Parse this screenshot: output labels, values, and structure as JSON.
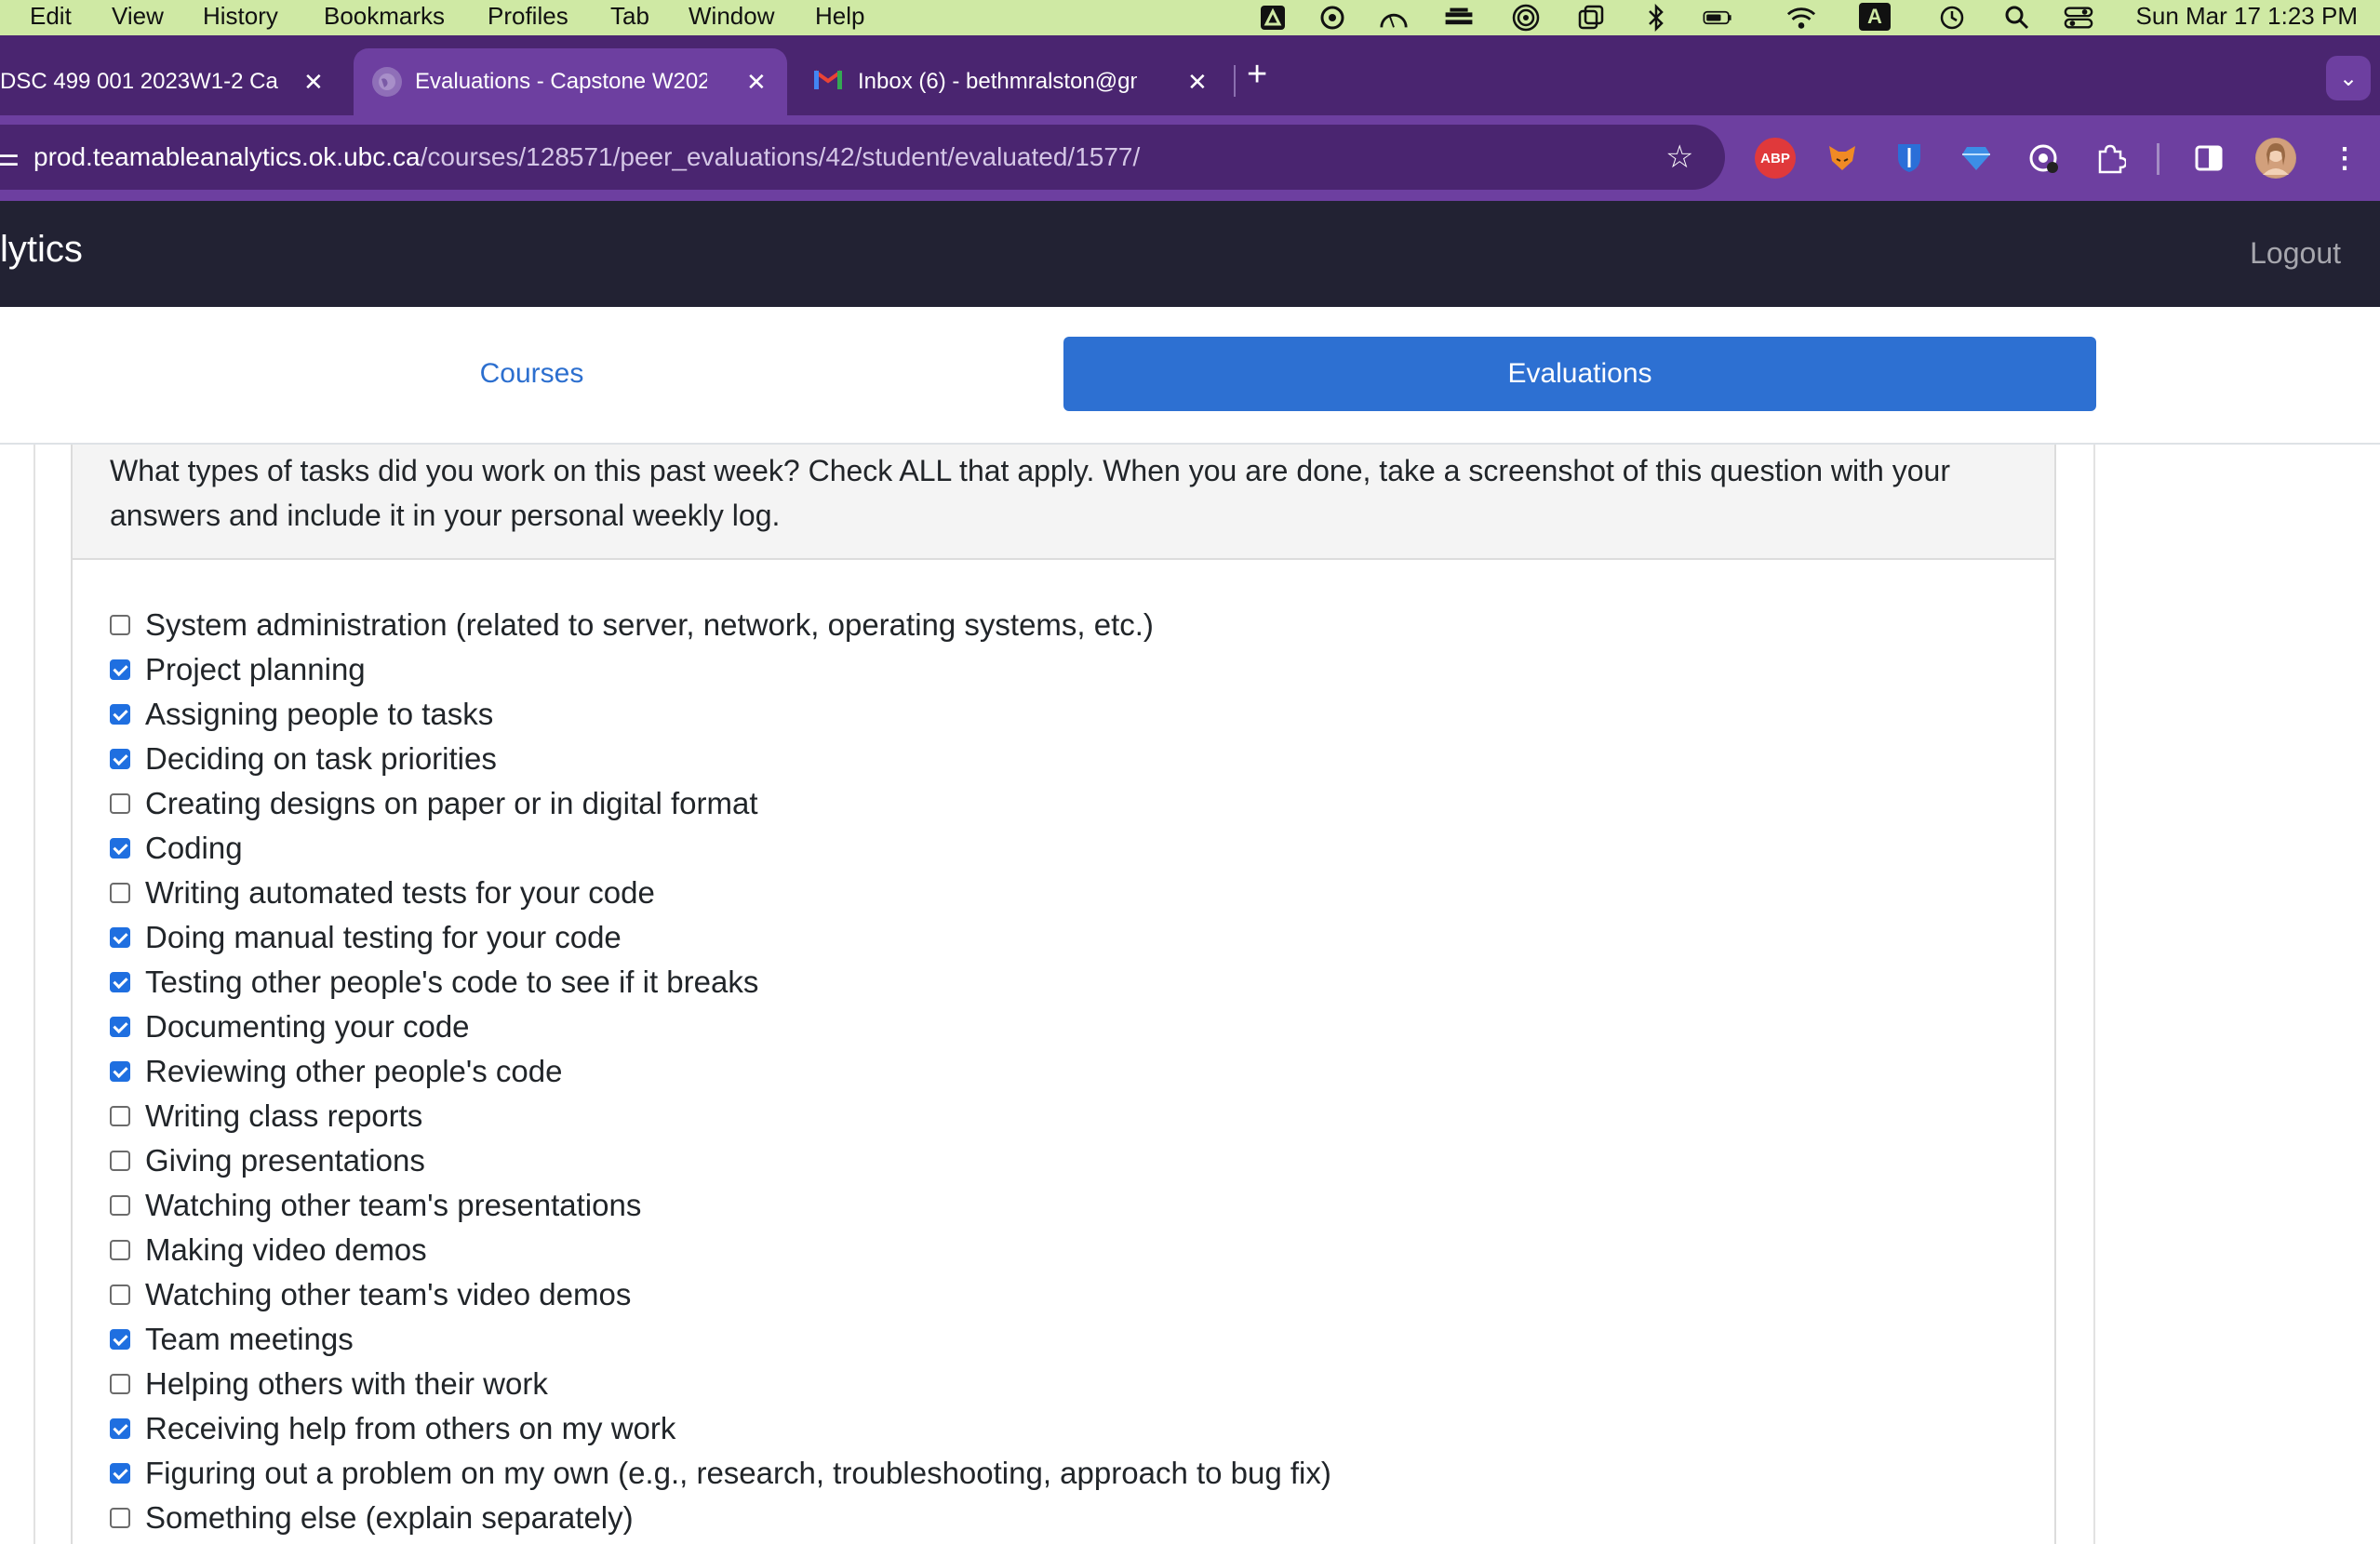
{
  "menubar": {
    "items": [
      "Edit",
      "View",
      "History",
      "Bookmarks",
      "Profiles",
      "Tab",
      "Window",
      "Help"
    ],
    "keyboard_badge": "A",
    "datetime": "Sun Mar 17  1:23 PM"
  },
  "tabs": [
    {
      "title": "DSC 499 001 2023W1-2 Ca",
      "active": false
    },
    {
      "title": "Evaluations - Capstone W202",
      "active": true
    },
    {
      "title": "Inbox (6) - bethmralston@gm",
      "active": false
    }
  ],
  "address": {
    "domain": "prod.teamableanalytics.ok.ubc.ca",
    "path": "/courses/128571/peer_evaluations/42/student/evaluated/1577/"
  },
  "extensions": {
    "abp_label": "ABP"
  },
  "site": {
    "brand": "lytics",
    "logout": "Logout"
  },
  "nav": {
    "courses": "Courses",
    "evaluations": "Evaluations"
  },
  "question": {
    "text": "What types of tasks did you work on this past week? Check ALL that apply. When you are done, take a screenshot of this question with your answers and include it in your personal weekly log.",
    "options": [
      {
        "label": "System administration (related to server, network, operating systems, etc.)",
        "checked": false
      },
      {
        "label": "Project planning",
        "checked": true
      },
      {
        "label": "Assigning people to tasks",
        "checked": true
      },
      {
        "label": "Deciding on task priorities",
        "checked": true
      },
      {
        "label": "Creating designs on paper or in digital format",
        "checked": false
      },
      {
        "label": "Coding",
        "checked": true
      },
      {
        "label": "Writing automated tests for your code",
        "checked": false
      },
      {
        "label": "Doing manual testing for your code",
        "checked": true
      },
      {
        "label": "Testing other people's code to see if it breaks",
        "checked": true
      },
      {
        "label": "Documenting your code",
        "checked": true
      },
      {
        "label": "Reviewing other people's code",
        "checked": true
      },
      {
        "label": "Writing class reports",
        "checked": false
      },
      {
        "label": "Giving presentations",
        "checked": false
      },
      {
        "label": "Watching other team's presentations",
        "checked": false
      },
      {
        "label": "Making video demos",
        "checked": false
      },
      {
        "label": "Watching other team's video demos",
        "checked": false
      },
      {
        "label": "Team meetings",
        "checked": true
      },
      {
        "label": "Helping others with their work",
        "checked": false
      },
      {
        "label": "Receiving help from others on my work",
        "checked": true
      },
      {
        "label": "Figuring out a problem on my own (e.g., research, troubleshooting, approach to bug fix)",
        "checked": true
      },
      {
        "label": "Something else (explain separately)",
        "checked": false
      }
    ]
  }
}
